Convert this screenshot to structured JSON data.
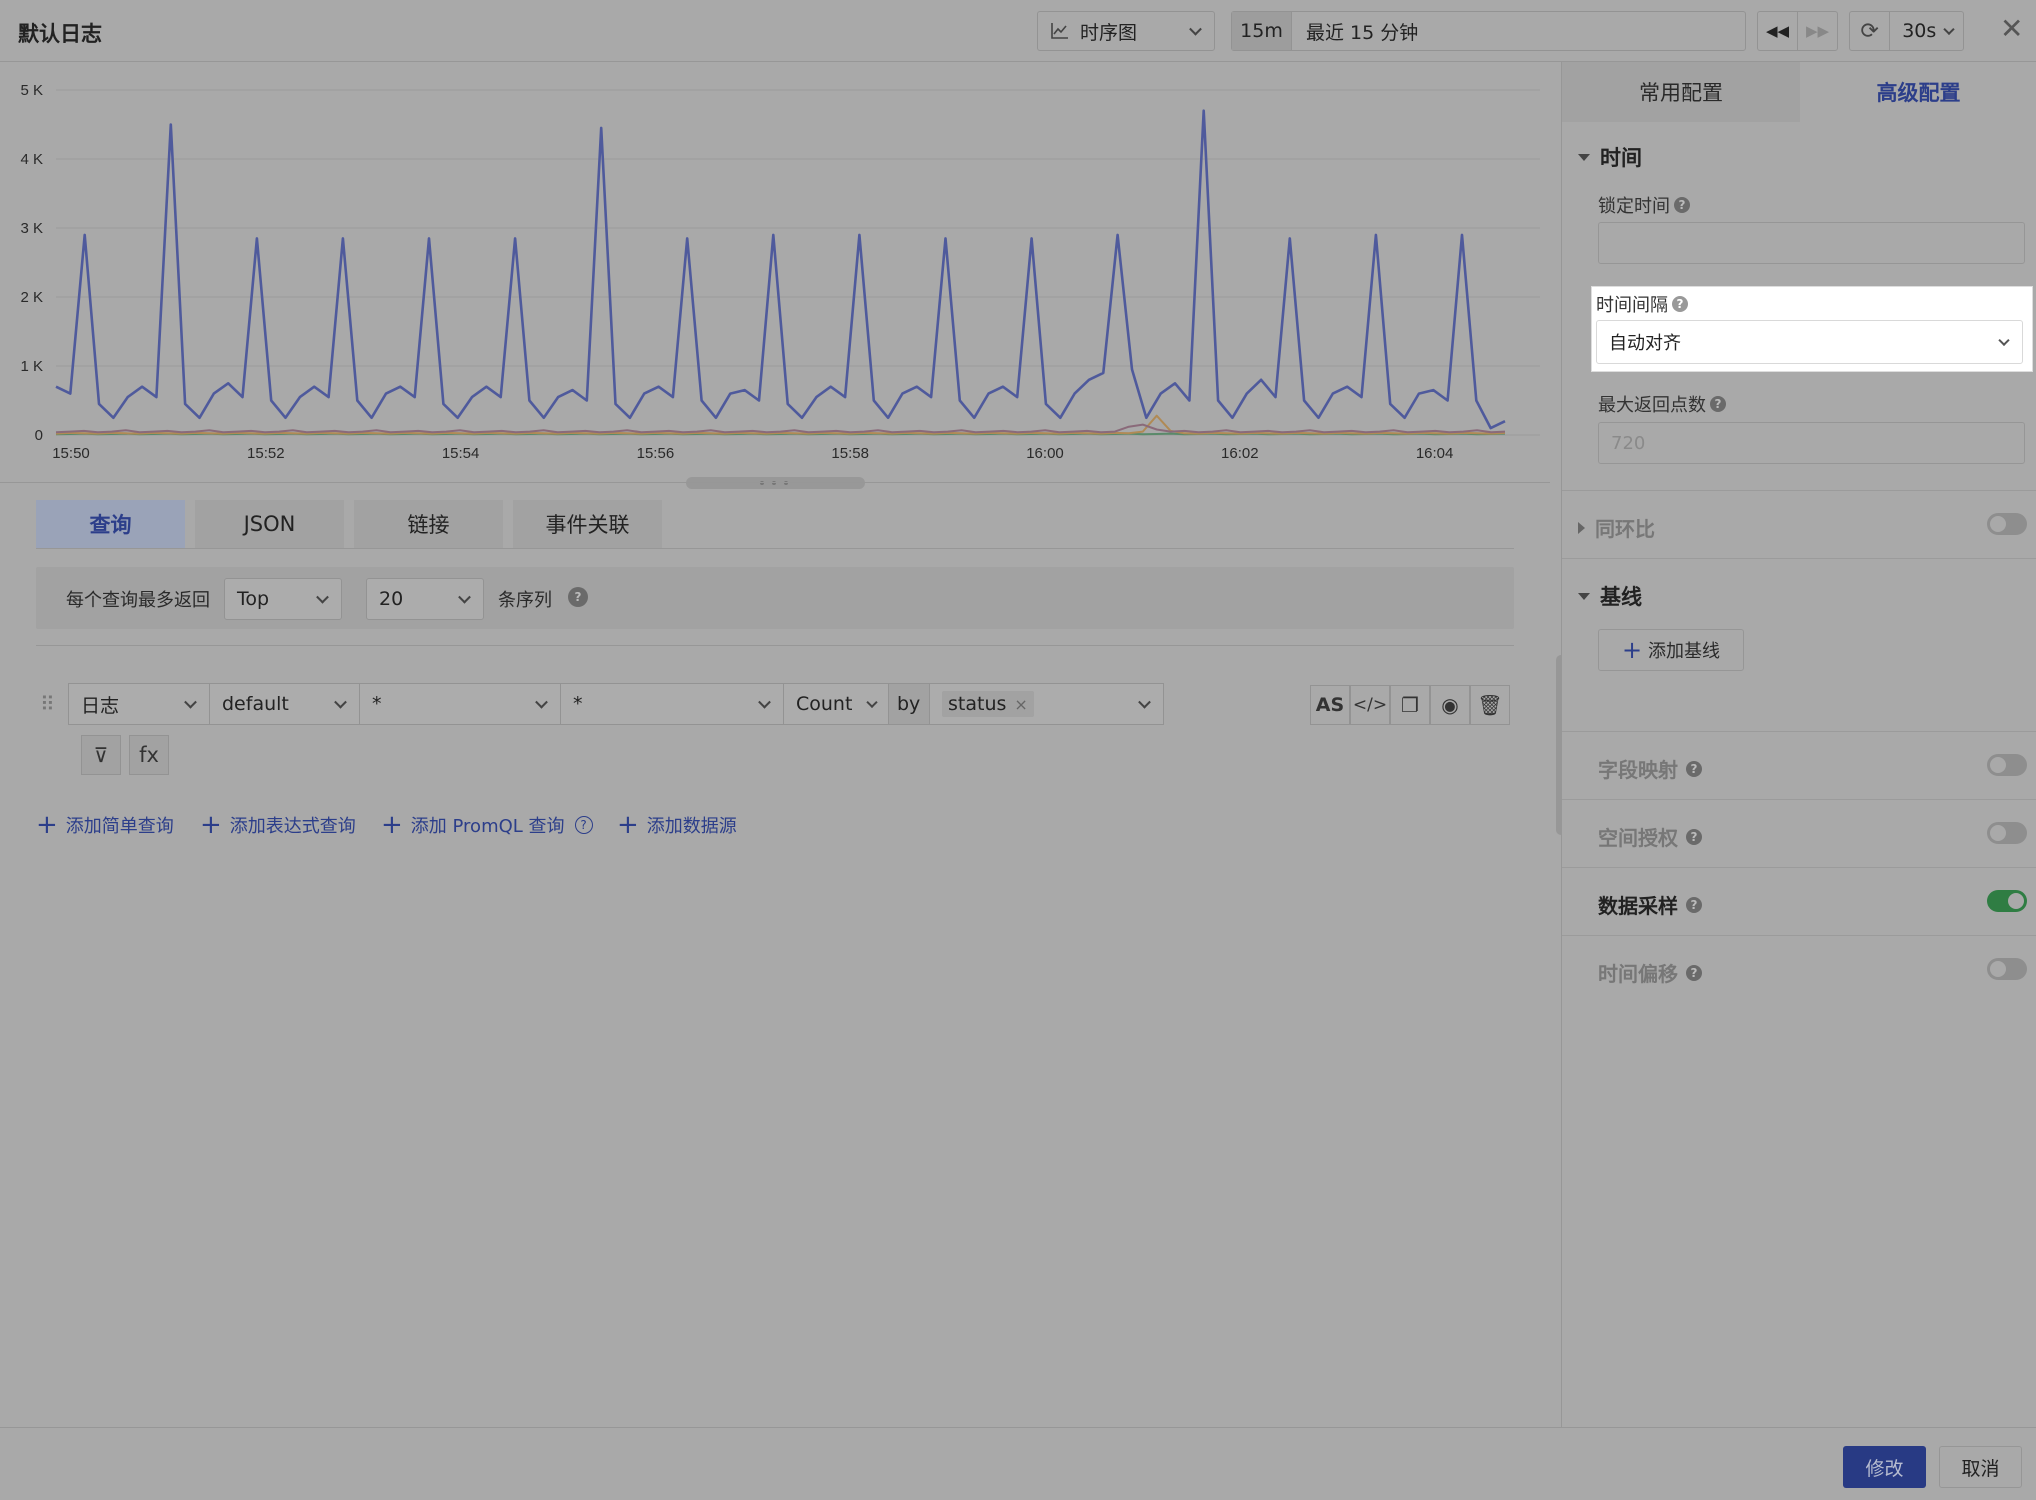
{
  "header": {
    "title": "默认日志",
    "chart_type_label": "时序图",
    "time_short": "15m",
    "time_range_label": "最近 15 分钟",
    "refresh_interval": "30s"
  },
  "tabs": [
    {
      "label": "查询"
    },
    {
      "label": "JSON"
    },
    {
      "label": "链接"
    },
    {
      "label": "事件关联"
    }
  ],
  "query_limit": {
    "prefix": "每个查询最多返回",
    "order": "Top",
    "count": "20",
    "suffix": "条序列"
  },
  "query_row": {
    "source": "日志",
    "index": "default",
    "filter": "*",
    "field": "*",
    "aggregation": "Count",
    "by_label": "by",
    "group_by_tag": "status",
    "group_by_remove": "×",
    "as_label": "AS",
    "filter_btn": "⊽",
    "fx_btn": "fx"
  },
  "add_links": [
    {
      "label": "添加简单查询"
    },
    {
      "label": "添加表达式查询"
    },
    {
      "label": "添加 PromQL 查询"
    },
    {
      "label": "添加数据源"
    }
  ],
  "right_panel": {
    "tabs": [
      {
        "label": "常用配置"
      },
      {
        "label": "高级配置"
      }
    ],
    "time_section": "时间",
    "lock_time_label": "锁定时间",
    "interval_label": "时间间隔",
    "interval_value": "自动对齐",
    "max_points_label": "最大返回点数",
    "max_points_placeholder": "720",
    "yoy_label": "同环比",
    "baseline_section": "基线",
    "add_baseline": "添加基线",
    "field_mapping": "字段映射",
    "space_auth": "空间授权",
    "data_sampling": "数据采样",
    "time_offset": "时间偏移",
    "toggles": {
      "yoy": false,
      "field_mapping": false,
      "space_auth": false,
      "data_sampling": true,
      "time_offset": false
    }
  },
  "footer": {
    "confirm": "修改",
    "cancel": "取消"
  },
  "chart_data": {
    "type": "line",
    "x_ticks": [
      "15:50",
      "15:52",
      "15:54",
      "15:56",
      "15:58",
      "16:00",
      "16:02",
      "16:04"
    ],
    "y_ticks": [
      "5 K",
      "4 K",
      "3 K",
      "2 K",
      "1 K",
      "0"
    ],
    "ylim": [
      0,
      5000
    ],
    "series": [
      {
        "color": "#4f5a9c",
        "values": [
          700,
          600,
          2900,
          450,
          250,
          550,
          700,
          550,
          4500,
          450,
          250,
          600,
          750,
          550,
          2850,
          500,
          250,
          550,
          700,
          550,
          2850,
          500,
          250,
          600,
          700,
          550,
          2850,
          450,
          250,
          550,
          700,
          550,
          2850,
          500,
          250,
          550,
          650,
          500,
          4450,
          450,
          250,
          600,
          700,
          550,
          2850,
          500,
          250,
          600,
          650,
          500,
          2900,
          450,
          250,
          550,
          700,
          550,
          2900,
          500,
          250,
          600,
          700,
          550,
          2850,
          500,
          250,
          600,
          700,
          550,
          2850,
          450,
          250,
          600,
          800,
          900,
          2900,
          950,
          250,
          600,
          750,
          500,
          4700,
          500,
          250,
          600,
          800,
          550,
          2850,
          500,
          250,
          600,
          700,
          550,
          2900,
          450,
          250,
          600,
          650,
          500,
          2900,
          500,
          100,
          200
        ]
      },
      {
        "color": "#8a6a7a",
        "values": [
          40,
          50,
          60,
          40,
          50,
          70,
          40,
          50,
          60,
          40,
          50,
          70,
          40,
          50,
          60,
          40,
          50,
          70,
          40,
          50,
          60,
          40,
          50,
          70,
          40,
          50,
          60,
          40,
          50,
          70,
          40,
          50,
          60,
          40,
          50,
          70,
          40,
          50,
          60,
          40,
          50,
          70,
          40,
          50,
          60,
          40,
          50,
          70,
          40,
          50,
          60,
          40,
          50,
          70,
          40,
          50,
          60,
          40,
          50,
          70,
          40,
          50,
          60,
          40,
          50,
          70,
          40,
          50,
          60,
          40,
          50,
          70,
          40,
          50,
          60,
          40,
          50,
          120,
          150,
          80,
          50,
          60,
          40,
          50,
          70,
          40,
          50,
          60,
          40,
          50,
          70,
          40,
          50,
          60,
          40,
          50,
          70,
          40,
          50,
          60,
          40,
          50,
          70,
          40,
          50
        ]
      },
      {
        "color": "#b08a55",
        "values": [
          20,
          30,
          25,
          20,
          30,
          25,
          20,
          30,
          25,
          20,
          30,
          25,
          20,
          30,
          25,
          20,
          30,
          25,
          20,
          30,
          25,
          20,
          30,
          25,
          20,
          30,
          25,
          20,
          30,
          25,
          20,
          30,
          25,
          20,
          30,
          25,
          20,
          30,
          25,
          20,
          30,
          25,
          20,
          30,
          25,
          20,
          30,
          25,
          20,
          30,
          25,
          20,
          30,
          25,
          20,
          30,
          25,
          20,
          30,
          25,
          20,
          30,
          25,
          20,
          30,
          25,
          20,
          30,
          25,
          20,
          30,
          25,
          20,
          30,
          25,
          20,
          30,
          25,
          50,
          280,
          60,
          25,
          20,
          30,
          25,
          20,
          30,
          25,
          20,
          30,
          25,
          20,
          30,
          25,
          20,
          30,
          25,
          20,
          30,
          25,
          20,
          30,
          25,
          20,
          30
        ]
      },
      {
        "color": "#5a8a6a",
        "values": [
          10,
          15,
          20,
          10,
          15,
          20,
          10,
          15,
          20,
          10,
          15,
          20,
          10,
          15,
          20,
          10,
          15,
          20,
          10,
          15,
          20,
          10,
          15,
          20,
          10,
          15,
          20,
          10,
          15,
          20,
          10,
          15,
          20,
          10,
          15,
          20,
          10,
          15,
          20,
          10,
          15,
          20,
          10,
          15,
          20,
          10,
          15,
          20,
          10,
          15,
          20,
          10,
          15,
          20,
          10,
          15,
          20,
          10,
          15,
          20,
          10,
          15,
          20,
          10,
          15,
          20,
          10,
          15,
          20,
          10,
          15,
          20,
          10,
          15,
          20,
          10,
          15,
          20,
          10,
          15,
          20,
          10,
          15,
          20,
          10,
          15,
          20,
          10,
          15,
          20,
          10,
          15,
          20,
          10,
          15,
          20,
          10,
          15,
          20,
          10,
          15,
          20,
          10,
          15,
          20
        ]
      }
    ]
  }
}
